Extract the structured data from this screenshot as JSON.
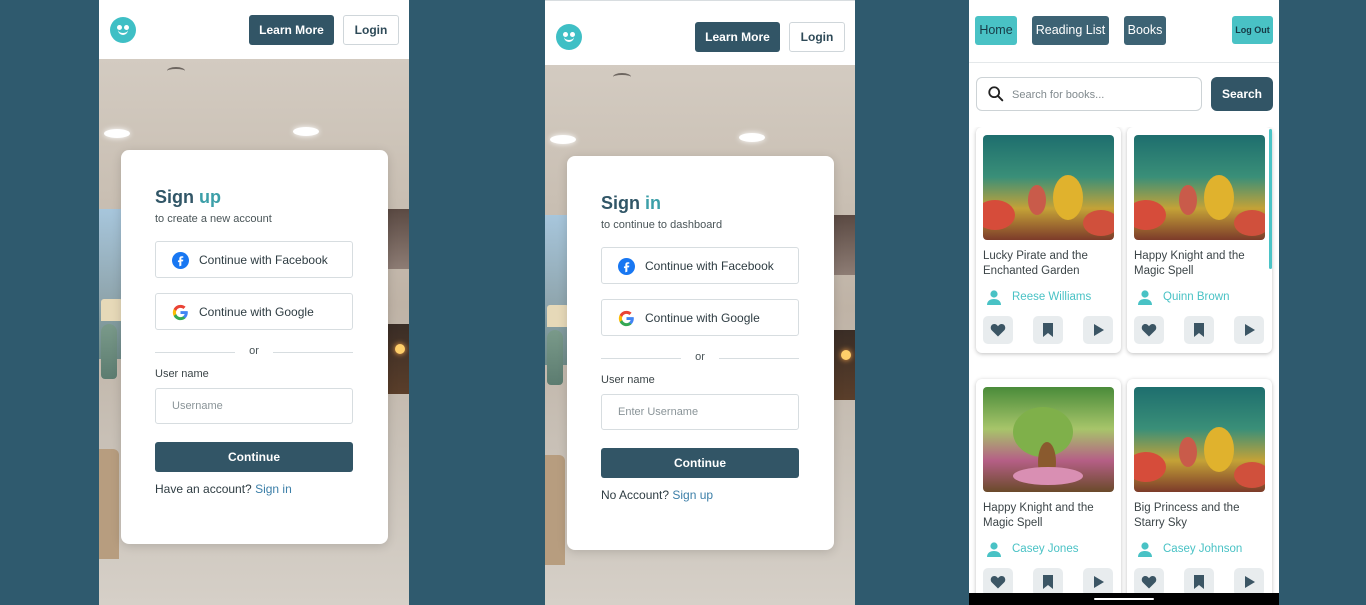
{
  "signup_screen": {
    "header": {
      "learn_more": "Learn More",
      "login": "Login"
    },
    "card": {
      "title_main": "Sign",
      "title_accent": "up",
      "subtitle": "to create a new account",
      "facebook": "Continue with Facebook",
      "google": "Continue with Google",
      "divider": "or",
      "username_label": "User name",
      "username_placeholder": "Username",
      "continue": "Continue",
      "switch_text": "Have an account?",
      "switch_link": "Sign in"
    }
  },
  "signin_screen": {
    "header": {
      "learn_more": "Learn More",
      "login": "Login"
    },
    "card": {
      "title_main": "Sign",
      "title_accent": "in",
      "subtitle": "to continue to dashboard",
      "facebook": "Continue with Facebook",
      "google": "Continue with Google",
      "divider": "or",
      "username_label": "User name",
      "username_placeholder": "Enter Username",
      "continue": "Continue",
      "switch_text": "No Account?",
      "switch_link": "Sign up"
    }
  },
  "library_screen": {
    "nav": {
      "home": "Home",
      "reading_list": "Reading List",
      "books": "Books",
      "logout": "Log Out"
    },
    "search": {
      "placeholder": "Search for books...",
      "button": "Search"
    },
    "books": [
      {
        "title": "Lucky Pirate and the Enchanted Garden",
        "author": "Reese Williams"
      },
      {
        "title": "Happy Knight and the Magic Spell",
        "author": "Quinn Brown"
      },
      {
        "title": "Happy Knight and the Magic Spell",
        "author": "Casey Jones"
      },
      {
        "title": "Big Princess and the Starry Sky",
        "author": "Casey Johnson"
      }
    ]
  },
  "colors": {
    "primary": "#325566",
    "accent": "#49c2c5",
    "background": "#2f5a6e"
  }
}
